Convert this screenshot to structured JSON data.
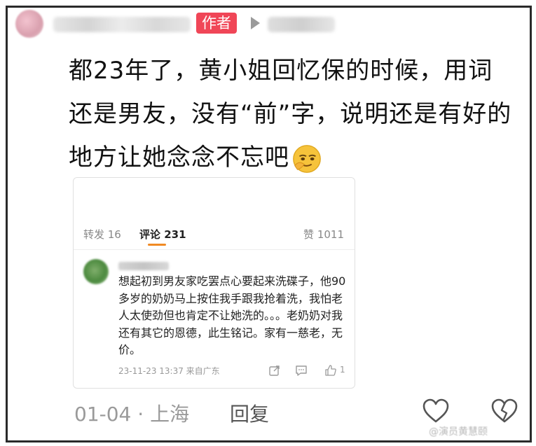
{
  "post": {
    "author_tag": "作者",
    "text": "都23年了，黄小姐回忆保的时候，用词还是男友，没有“前”字，说明还是有好的地方让她念念不忘吧"
  },
  "embedded": {
    "tabs": {
      "repost": "转发 16",
      "comment": "评论 231",
      "like": "赞 1011"
    },
    "comment": {
      "text": "想起初到男友家吃罢点心要起来洗碟子，他90多岁的奶奶马上按住我手跟我抢着洗，我怕老人太使劲但也肯定不让她洗的。。。老奶奶对我还有其它的恩德，此生铭记。家有一慈老，无价。",
      "date_source": "23-11-23 13:37 来自广东",
      "like_count": "1"
    }
  },
  "footer": {
    "date_location": "01-04 · 上海",
    "reply": "回复"
  },
  "watermark": "@演员黄慧颐",
  "icons": [
    "play-icon",
    "emoji-smirk-icon",
    "share-icon",
    "reply-icon",
    "thumbs-up-icon",
    "heart-icon",
    "broken-heart-icon"
  ],
  "colors": {
    "author_tag": "#f04657",
    "tab_underline": "#f08a24"
  }
}
